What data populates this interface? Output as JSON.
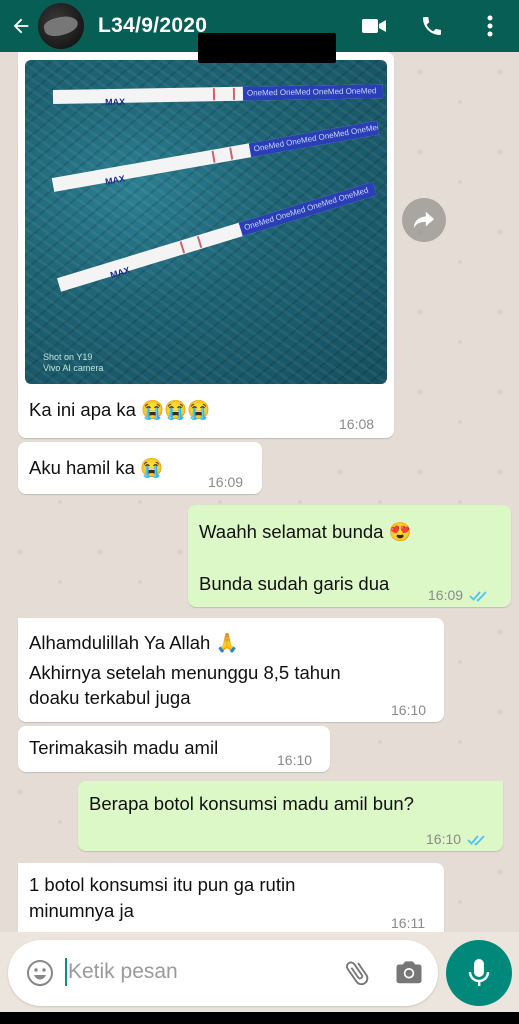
{
  "header": {
    "title": "L34/9/2020",
    "back_icon": "arrow-left-icon",
    "icons": [
      "video-call-icon",
      "phone-icon",
      "more-vert-icon"
    ]
  },
  "photo": {
    "strip_label": "MAX",
    "brand": "OneMed OneMed OneMed OneMed",
    "watermark_line1": "Shot on Y19",
    "watermark_line2": "Vivo AI camera"
  },
  "messages": [
    {
      "type": "in",
      "text": "Ka ini apa ka 😭😭😭",
      "time": "16:08"
    },
    {
      "type": "in",
      "text": "Aku hamil ka 😭",
      "time": "16:09"
    },
    {
      "type": "out",
      "text1": "Waahh selamat bunda 😍",
      "text2": "Bunda sudah garis dua",
      "time": "16:09"
    },
    {
      "type": "in",
      "text1": "Alhamdulillah Ya Allah 🙏",
      "text2": "Akhirnya setelah menunggu 8,5 tahun",
      "text3": "doaku terkabul juga",
      "time": "16:10"
    },
    {
      "type": "in",
      "text": "Terimakasih madu amil",
      "time": "16:10"
    },
    {
      "type": "out",
      "text": "Berapa botol konsumsi madu amil bun?",
      "time": "16:10"
    },
    {
      "type": "in",
      "text1": "1 botol konsumsi itu pun ga rutin",
      "text2": "minumnya ja",
      "time": "16:11"
    }
  ],
  "input": {
    "placeholder": "Ketik pesan"
  },
  "colors": {
    "header": "#075e54",
    "outgoing": "#dcf8c6",
    "incoming": "#ffffff",
    "mic": "#00897b",
    "read_ticks": "#4fc3f7"
  }
}
